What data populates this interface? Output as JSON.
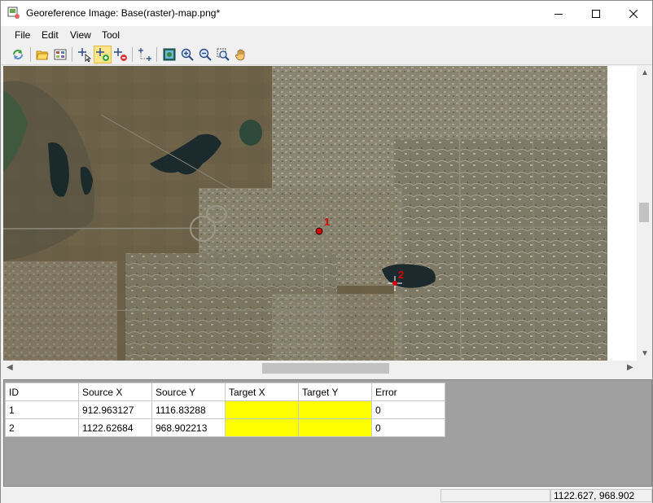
{
  "window": {
    "title": "Georeference Image: Base(raster)-map.png*",
    "controls": [
      "minimize",
      "maximize",
      "close"
    ]
  },
  "menu": [
    "File",
    "Edit",
    "View",
    "Tool"
  ],
  "toolbar": {
    "buttons": [
      "refresh-icon",
      "open-folder-icon",
      "open-raster-icon",
      "select-point-icon",
      "add-point-icon",
      "delete-point-icon",
      "move-point-icon",
      "full-extent-icon",
      "zoom-in-icon",
      "zoom-out-icon",
      "zoom-box-icon",
      "pan-hand-icon"
    ],
    "active": "add-point-icon"
  },
  "map": {
    "markers": [
      {
        "label": "1",
        "style": "red-dot"
      },
      {
        "label": "2",
        "style": "crosshair"
      }
    ]
  },
  "gcp_table": {
    "columns": [
      "ID",
      "Source X",
      "Source Y",
      "Target X",
      "Target Y",
      "Error"
    ],
    "rows": [
      {
        "id": "1",
        "source_x": "912.963127",
        "source_y": "1116.83288",
        "target_x": "",
        "target_y": "",
        "error": "0"
      },
      {
        "id": "2",
        "source_x": "1122.62684",
        "source_y": "968.902213",
        "target_x": "",
        "target_y": "",
        "error": "0"
      }
    ],
    "highlight_color": "#ffff00"
  },
  "status": {
    "coordinates": "1122.627, 968.902"
  }
}
